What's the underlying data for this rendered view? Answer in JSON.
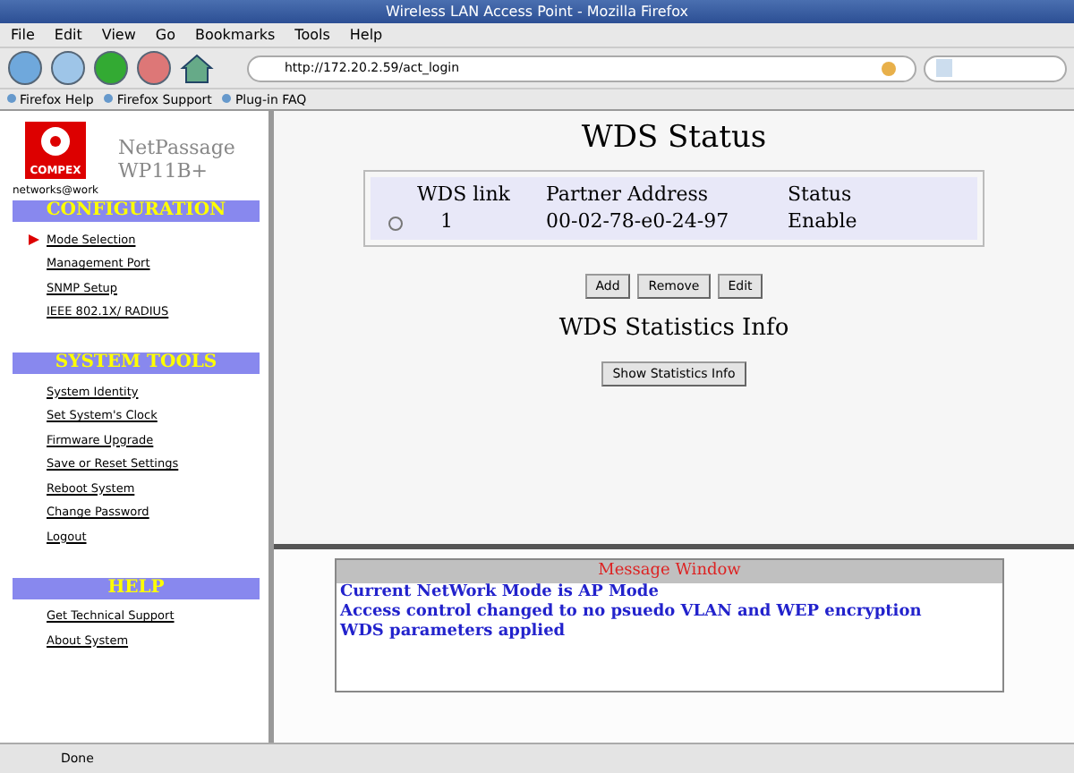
{
  "window": {
    "title": "Wireless LAN Access Point - Mozilla Firefox"
  },
  "menu": [
    "File",
    "Edit",
    "View",
    "Go",
    "Bookmarks",
    "Tools",
    "Help"
  ],
  "address": {
    "value": "http://172.20.2.59/act_login"
  },
  "bookmarks": [
    "Firefox Help",
    "Firefox Support",
    "Plug-in FAQ"
  ],
  "sidebar": {
    "logo": "COMPEX",
    "tagline": "networks@work",
    "product": [
      "NetPassage",
      "WP11B+"
    ],
    "sections": [
      {
        "title": "CONFIGURATION",
        "items": [
          {
            "label": "Mode Selection",
            "selected": true
          },
          {
            "label": "Management Port",
            "selected": false
          },
          {
            "label": "SNMP Setup",
            "selected": false
          },
          {
            "label": "IEEE 802.1X/ RADIUS",
            "selected": false
          }
        ]
      },
      {
        "title": "SYSTEM TOOLS",
        "items": [
          {
            "label": "System Identity",
            "selected": false
          },
          {
            "label": "Set System's Clock",
            "selected": false
          },
          {
            "label": "Firmware Upgrade",
            "selected": false
          },
          {
            "label": "Save or Reset Settings",
            "selected": false
          },
          {
            "label": "Reboot System",
            "selected": false
          },
          {
            "label": "Change Password",
            "selected": false
          },
          {
            "label": "Logout",
            "selected": false
          }
        ]
      },
      {
        "title": "HELP",
        "items": [
          {
            "label": "Get Technical Support",
            "selected": false
          },
          {
            "label": "About System",
            "selected": false
          }
        ]
      }
    ]
  },
  "main": {
    "title": "WDS Status",
    "table": {
      "columns": [
        "WDS link",
        "Partner Address",
        "Status"
      ],
      "rows": [
        {
          "selected": false,
          "cells": [
            "1",
            "00-02-78-e0-24-97",
            "Enable"
          ]
        }
      ]
    },
    "buttons": [
      "Add",
      "Remove",
      "Edit"
    ],
    "stats_title": "WDS Statistics Info",
    "stats_button": "Show Statistics Info"
  },
  "message_window": {
    "title": "Message Window",
    "lines": [
      "Current NetWork Mode is AP Mode",
      "Access control changed to no psuedo VLAN and WEP encryption",
      "WDS parameters applied"
    ]
  },
  "status_bar": {
    "text": "Done"
  }
}
